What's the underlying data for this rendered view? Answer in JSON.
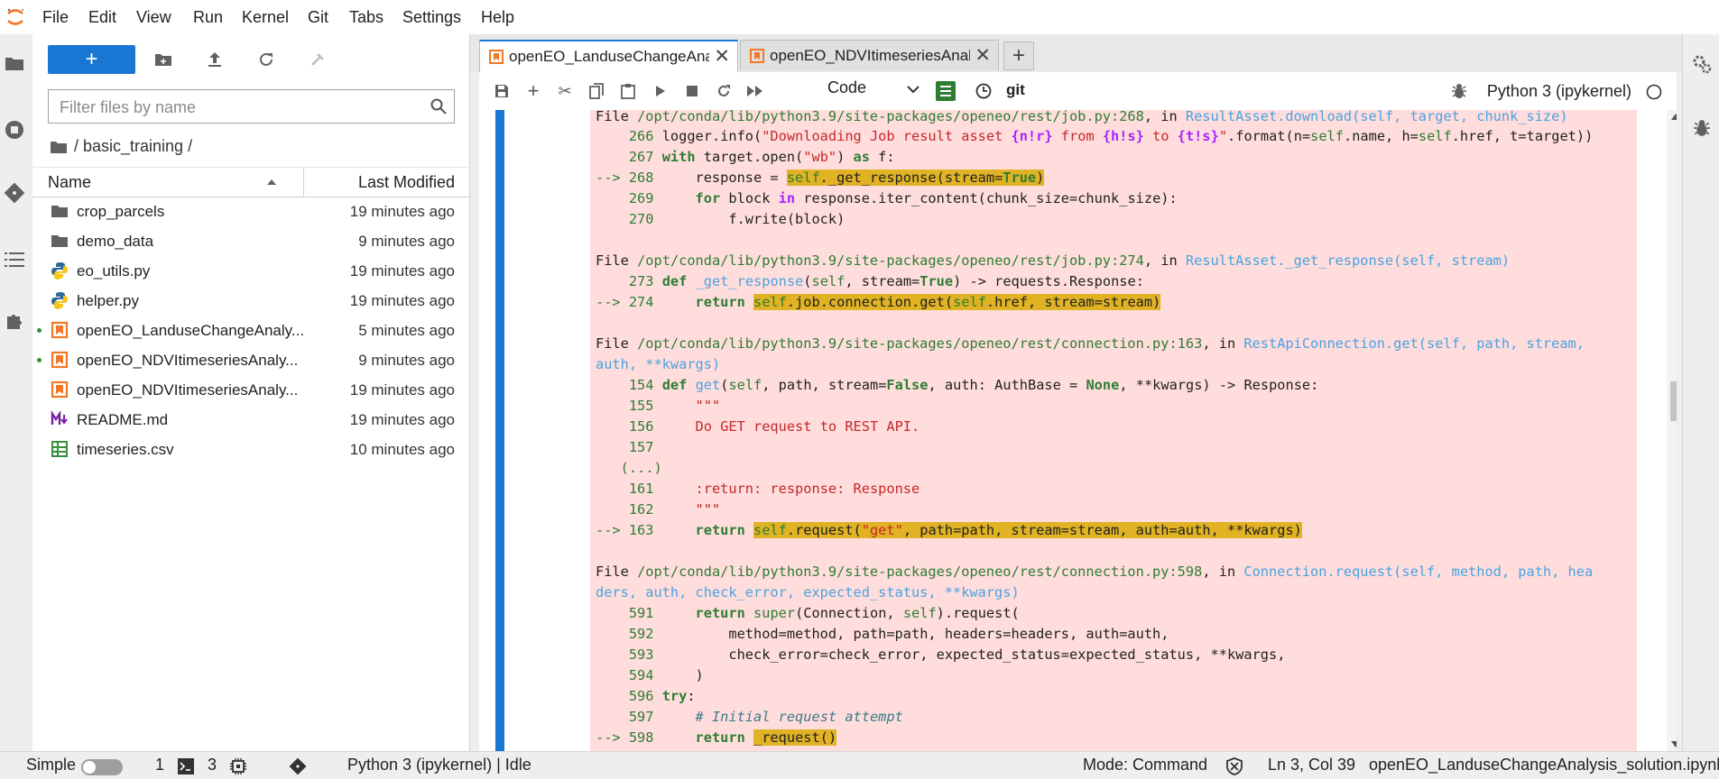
{
  "menubar": {
    "items": [
      "File",
      "Edit",
      "View",
      "Run",
      "Kernel",
      "Git",
      "Tabs",
      "Settings",
      "Help"
    ]
  },
  "filebrowser": {
    "new_label": "+",
    "filter_placeholder": "Filter files by name",
    "breadcrumb": "/ basic_training /",
    "columns": {
      "name": "Name",
      "modified": "Last Modified"
    },
    "files": [
      {
        "name": "crop_parcels",
        "modified": "19 minutes ago",
        "icon": "folder-icon",
        "running": false
      },
      {
        "name": "demo_data",
        "modified": "9 minutes ago",
        "icon": "folder-icon",
        "running": false
      },
      {
        "name": "eo_utils.py",
        "modified": "19 minutes ago",
        "icon": "python-icon",
        "running": false
      },
      {
        "name": "helper.py",
        "modified": "19 minutes ago",
        "icon": "python-icon",
        "running": false
      },
      {
        "name": "openEO_LanduseChangeAnaly...",
        "modified": "5 minutes ago",
        "icon": "notebook-icon",
        "running": true
      },
      {
        "name": "openEO_NDVItimeseriesAnaly...",
        "modified": "9 minutes ago",
        "icon": "notebook-icon",
        "running": true
      },
      {
        "name": "openEO_NDVItimeseriesAnaly...",
        "modified": "19 minutes ago",
        "icon": "notebook-icon",
        "running": false
      },
      {
        "name": "README.md",
        "modified": "19 minutes ago",
        "icon": "markdown-icon",
        "running": false
      },
      {
        "name": "timeseries.csv",
        "modified": "10 minutes ago",
        "icon": "csv-icon",
        "running": false
      }
    ]
  },
  "tabs": [
    {
      "label": "openEO_LanduseChangeAna",
      "active": true
    },
    {
      "label": "openEO_NDVItimeseriesAnal",
      "active": false
    }
  ],
  "toolbar": {
    "cell_type": "Code",
    "git_label": "git",
    "kernel": "Python 3 (ipykernel)"
  },
  "statusbar": {
    "mode_label": "Simple",
    "terminals_count": "1",
    "kernels_count": "3",
    "kernel_status": "Python 3 (ipykernel) | Idle",
    "mode": "Mode: Command",
    "cursor": "Ln 3, Col 39",
    "filename": "openEO_LanduseChangeAnalysis_solution.ipynb"
  },
  "colors": {
    "accent": "#1976d2",
    "error_bg": "#ffdddd",
    "highlight": "#e0b224"
  }
}
